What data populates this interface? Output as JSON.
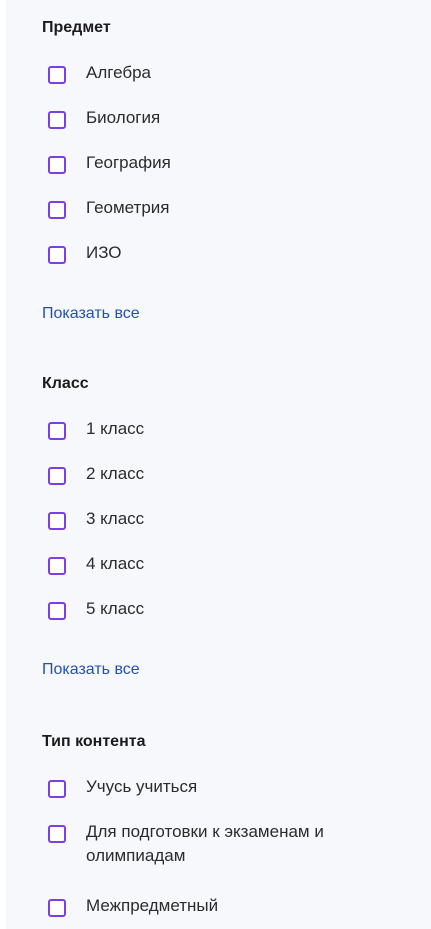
{
  "filters": {
    "subject": {
      "title": "Предмет",
      "options": [
        "Алгебра",
        "Биология",
        "География",
        "Геометрия",
        "ИЗО"
      ],
      "show_all": "Показать все"
    },
    "grade": {
      "title": "Класс",
      "options": [
        "1 класс",
        "2 класс",
        "3 класс",
        "4 класс",
        "5 класс"
      ],
      "show_all": "Показать все"
    },
    "content_type": {
      "title": "Тип контента",
      "options": [
        "Учусь учиться",
        "Для подготовки к экзаменам и олимпиадам",
        "Межпредметный"
      ]
    }
  },
  "colors": {
    "checkbox_border": "#7b3fe4",
    "link": "#2450b2",
    "panel_bg": "#f7f8fb"
  }
}
